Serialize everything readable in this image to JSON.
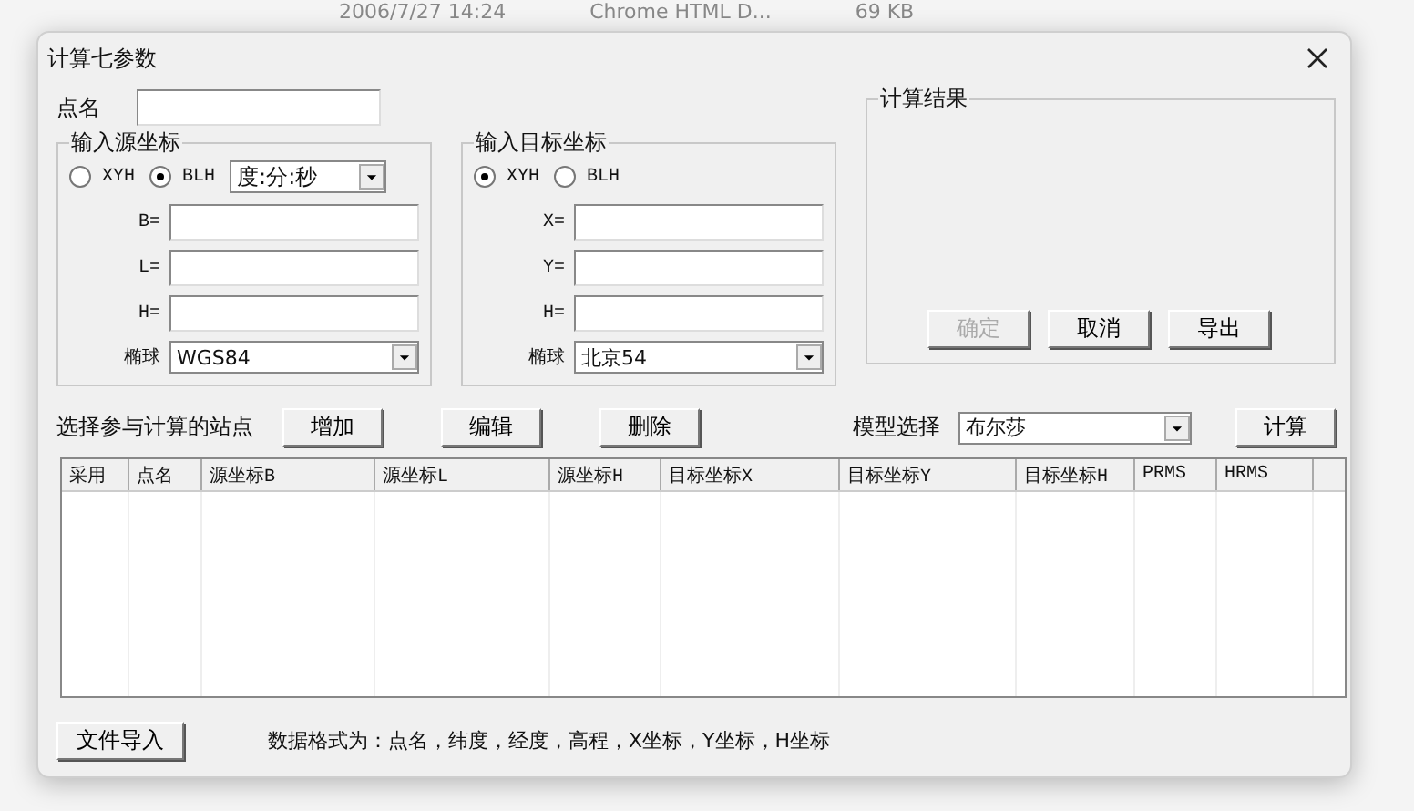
{
  "background_file_row": {
    "date": "2006/7/27 14:24",
    "type": "Chrome HTML D...",
    "size": "69 KB"
  },
  "window": {
    "title": "计算七参数"
  },
  "point_name": {
    "label": "点名"
  },
  "source_group": {
    "title": "输入源坐标",
    "modes": [
      {
        "label": "XYH",
        "selected": false
      },
      {
        "label": "BLH",
        "selected": true
      }
    ],
    "angle_format": "度:分:秒",
    "fields": [
      {
        "label": "B="
      },
      {
        "label": "L="
      },
      {
        "label": "H="
      }
    ],
    "ellipsoid": {
      "label": "椭球",
      "value": "WGS84"
    }
  },
  "target_group": {
    "title": "输入目标坐标",
    "modes": [
      {
        "label": "XYH",
        "selected": true
      },
      {
        "label": "BLH",
        "selected": false
      }
    ],
    "fields": [
      {
        "label": "X="
      },
      {
        "label": "Y="
      },
      {
        "label": "H="
      }
    ],
    "ellipsoid": {
      "label": "椭球",
      "value": "北京54"
    }
  },
  "result_group": {
    "title": "计算结果",
    "buttons": [
      {
        "label": "确定",
        "disabled": true
      },
      {
        "label": "取消",
        "disabled": false
      },
      {
        "label": "导出",
        "disabled": false
      }
    ]
  },
  "stations": {
    "label": "选择参与计算的站点",
    "buttons": [
      "增加",
      "编辑",
      "删除"
    ],
    "model_label": "模型选择",
    "model_value": "布尔莎",
    "compute_button": "计算"
  },
  "table": {
    "columns": [
      "采用",
      "点名",
      "源坐标B",
      "源坐标L",
      "源坐标H",
      "目标坐标X",
      "目标坐标Y",
      "目标坐标H",
      "PRMS",
      "HRMS"
    ]
  },
  "footer": {
    "import_button": "文件导入",
    "format_note": "数据格式为：点名，纬度，经度，高程，X坐标，Y坐标，H坐标"
  }
}
